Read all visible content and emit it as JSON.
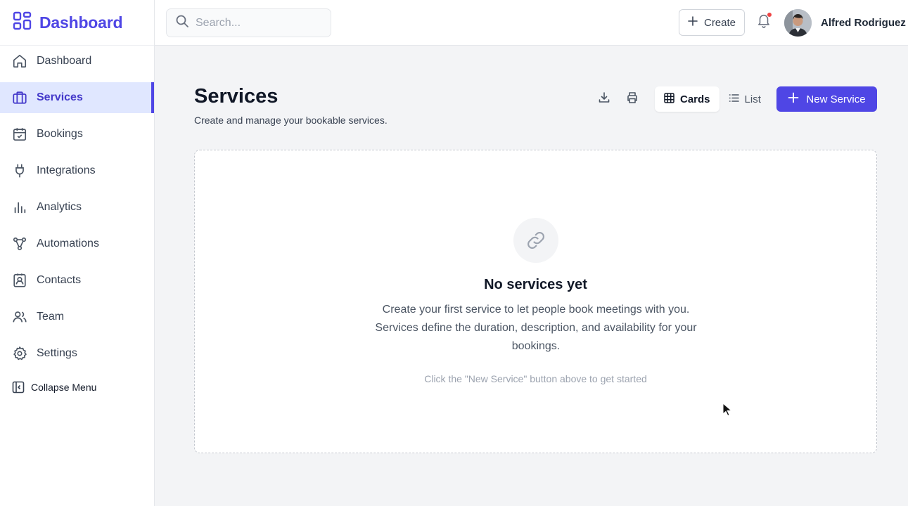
{
  "sidebar": {
    "brand": "Dashboard",
    "items": [
      {
        "label": "Dashboard",
        "icon": "home-icon"
      },
      {
        "label": "Services",
        "icon": "briefcase-icon",
        "active": true
      },
      {
        "label": "Bookings",
        "icon": "calendar-check-icon"
      },
      {
        "label": "Integrations",
        "icon": "plug-icon"
      },
      {
        "label": "Analytics",
        "icon": "bar-chart-icon"
      },
      {
        "label": "Automations",
        "icon": "workflow-icon"
      },
      {
        "label": "Contacts",
        "icon": "contact-card-icon"
      },
      {
        "label": "Team",
        "icon": "users-icon"
      },
      {
        "label": "Settings",
        "icon": "gear-icon"
      }
    ],
    "collapse_label": "Collapse Menu"
  },
  "topbar": {
    "search_placeholder": "Search...",
    "create_label": "Create",
    "user_name": "Alfred Rodriguez"
  },
  "main": {
    "title": "Services",
    "subtitle": "Create and manage your bookable services.",
    "view_cards": "Cards",
    "view_list": "List",
    "new_service_label": "New Service",
    "empty": {
      "title": "No services yet",
      "description": "Create your first service to let people book meetings with you. Services define the duration, description, and availability for your bookings.",
      "hint": "Click the \"New Service\" button above to get started"
    }
  },
  "colors": {
    "accent": "#4f46e5",
    "active_bg": "#e0e7ff",
    "notification_dot": "#ef4444"
  }
}
